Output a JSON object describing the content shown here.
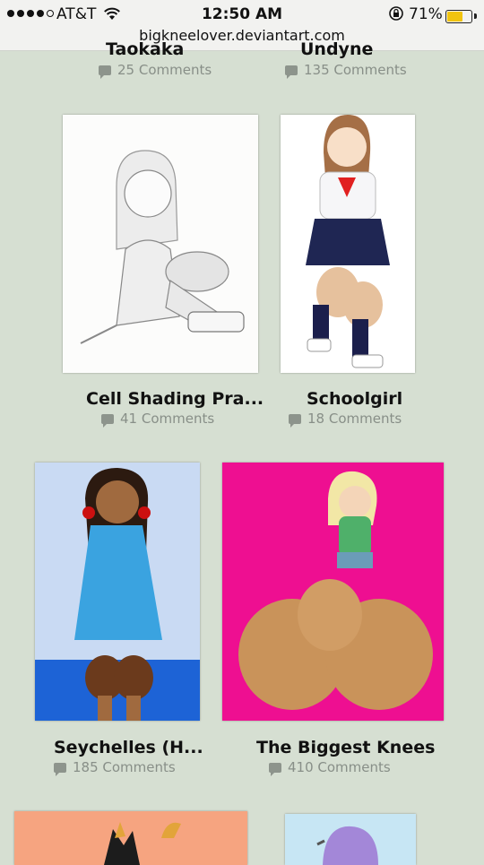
{
  "status_bar": {
    "carrier": "AT&T",
    "time": "12:50 AM",
    "battery_percent": "71%",
    "battery_level": 0.71,
    "url": "bigkneelover.deviantart.com"
  },
  "gallery": {
    "items": [
      {
        "title": "Taokaka",
        "comments": "25 Comments"
      },
      {
        "title": "Undyne",
        "comments": "135 Comments"
      },
      {
        "title": "Cell Shading Pra...",
        "comments": "41 Comments"
      },
      {
        "title": "Schoolgirl",
        "comments": "18 Comments"
      },
      {
        "title": "Seychelles (H...",
        "comments": "185 Comments"
      },
      {
        "title": "The Biggest Knees",
        "comments": "410 Comments"
      }
    ]
  }
}
